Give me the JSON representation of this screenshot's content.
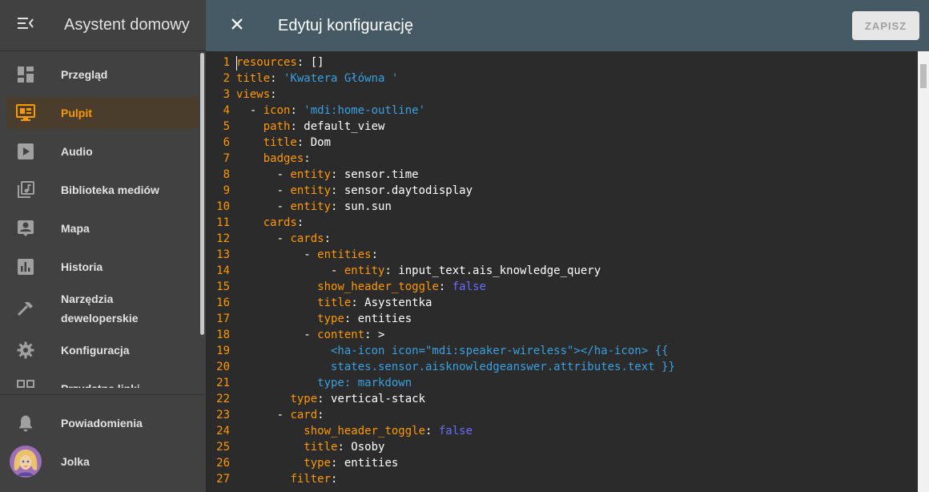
{
  "app": {
    "title": "Asystent domowy"
  },
  "sidebar": {
    "items": [
      {
        "label": "Przegląd",
        "icon": "dashboard-icon"
      },
      {
        "label": "Pulpit",
        "icon": "monitor-dashboard-icon",
        "active": true
      },
      {
        "label": "Audio",
        "icon": "play-box-icon"
      },
      {
        "label": "Biblioteka mediów",
        "icon": "music-library-icon"
      },
      {
        "label": "Mapa",
        "icon": "account-box-icon"
      },
      {
        "label": "Historia",
        "icon": "chart-box-icon"
      },
      {
        "label": "Narzędzia deweloperskie",
        "line1": "Narzędzia",
        "line2": "deweloperskie",
        "icon": "hammer-icon"
      },
      {
        "label": "Konfiguracja",
        "icon": "gear-icon"
      },
      {
        "label": "Przydatne linki",
        "icon": "link-icon"
      }
    ],
    "footer": [
      {
        "label": "Powiadomienia",
        "icon": "bell-icon"
      },
      {
        "label": "Jolka",
        "icon": "avatar"
      }
    ]
  },
  "editor": {
    "title": "Edytuj konfigurację",
    "save_label": "ZAPISZ",
    "line_numbers": [
      "1",
      "2",
      "3",
      "4",
      "5",
      "6",
      "7",
      "8",
      "9",
      "10",
      "11",
      "12",
      "13",
      "14",
      "15",
      "16",
      "17",
      "18",
      "19",
      "20",
      "21",
      "22",
      "23",
      "24",
      "25",
      "26",
      "27"
    ],
    "lines": [
      [
        {
          "t": "resources",
          "c": "k"
        },
        {
          "t": ": []"
        }
      ],
      [
        {
          "t": "title",
          "c": "k"
        },
        {
          "t": ": "
        },
        {
          "t": "'Kwatera Główna '",
          "c": "s"
        }
      ],
      [
        {
          "t": "views",
          "c": "k"
        },
        {
          "t": ":"
        }
      ],
      [
        {
          "t": "  - "
        },
        {
          "t": "icon",
          "c": "k"
        },
        {
          "t": ": "
        },
        {
          "t": "'mdi:home-outline'",
          "c": "s"
        }
      ],
      [
        {
          "t": "    "
        },
        {
          "t": "path",
          "c": "k"
        },
        {
          "t": ": default_view"
        }
      ],
      [
        {
          "t": "    "
        },
        {
          "t": "title",
          "c": "k"
        },
        {
          "t": ": Dom"
        }
      ],
      [
        {
          "t": "    "
        },
        {
          "t": "badges",
          "c": "k"
        },
        {
          "t": ":"
        }
      ],
      [
        {
          "t": "      - "
        },
        {
          "t": "entity",
          "c": "k"
        },
        {
          "t": ": sensor.time"
        }
      ],
      [
        {
          "t": "      - "
        },
        {
          "t": "entity",
          "c": "k"
        },
        {
          "t": ": sensor.daytodisplay"
        }
      ],
      [
        {
          "t": "      - "
        },
        {
          "t": "entity",
          "c": "k"
        },
        {
          "t": ": sun.sun"
        }
      ],
      [
        {
          "t": "    "
        },
        {
          "t": "cards",
          "c": "k"
        },
        {
          "t": ":"
        }
      ],
      [
        {
          "t": "      - "
        },
        {
          "t": "cards",
          "c": "k"
        },
        {
          "t": ":"
        }
      ],
      [
        {
          "t": "          - "
        },
        {
          "t": "entities",
          "c": "k"
        },
        {
          "t": ":"
        }
      ],
      [
        {
          "t": "              - "
        },
        {
          "t": "entity",
          "c": "k"
        },
        {
          "t": ": input_text.ais_knowledge_query"
        }
      ],
      [
        {
          "t": "            "
        },
        {
          "t": "show_header_toggle",
          "c": "k"
        },
        {
          "t": ": "
        },
        {
          "t": "false",
          "c": "b"
        }
      ],
      [
        {
          "t": "            "
        },
        {
          "t": "title",
          "c": "k"
        },
        {
          "t": ": Asystentka"
        }
      ],
      [
        {
          "t": "            "
        },
        {
          "t": "type",
          "c": "k"
        },
        {
          "t": ": entities"
        }
      ],
      [
        {
          "t": "          - "
        },
        {
          "t": "content",
          "c": "k"
        },
        {
          "t": ": >"
        }
      ],
      [
        {
          "t": "              <ha-icon icon=\"mdi:speaker-wireless\"></ha-icon> {{",
          "c": "s"
        }
      ],
      [
        {
          "t": "              states.sensor.aisknowledgeanswer.attributes.text }}",
          "c": "s"
        }
      ],
      [
        {
          "t": "            type: markdown",
          "c": "s"
        }
      ],
      [
        {
          "t": "        "
        },
        {
          "t": "type",
          "c": "k"
        },
        {
          "t": ": vertical-stack"
        }
      ],
      [
        {
          "t": "      - "
        },
        {
          "t": "card",
          "c": "k"
        },
        {
          "t": ":"
        }
      ],
      [
        {
          "t": "          "
        },
        {
          "t": "show_header_toggle",
          "c": "k"
        },
        {
          "t": ": "
        },
        {
          "t": "false",
          "c": "b"
        }
      ],
      [
        {
          "t": "          "
        },
        {
          "t": "title",
          "c": "k"
        },
        {
          "t": ": Osoby"
        }
      ],
      [
        {
          "t": "          "
        },
        {
          "t": "type",
          "c": "k"
        },
        {
          "t": ": entities"
        }
      ],
      [
        {
          "t": "        "
        },
        {
          "t": "filter",
          "c": "k"
        },
        {
          "t": ":"
        }
      ]
    ]
  }
}
